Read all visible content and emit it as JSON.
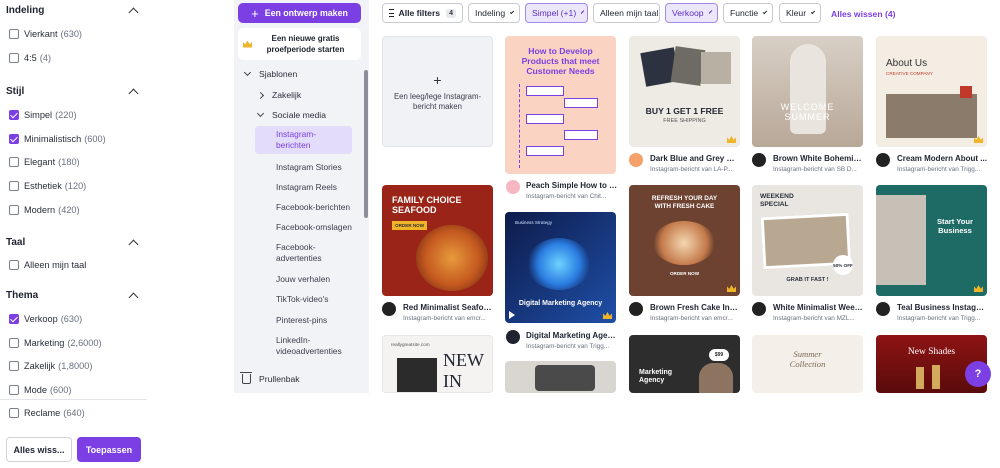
{
  "filters": {
    "sections": [
      {
        "key": "indeling",
        "title": "Indeling",
        "options": [
          {
            "label": "Vierkant",
            "count": "(630)",
            "checked": false
          },
          {
            "label": "4:5",
            "count": "(4)",
            "checked": false
          }
        ]
      },
      {
        "key": "stijl",
        "title": "Stijl",
        "options": [
          {
            "label": "Simpel",
            "count": "(220)",
            "checked": true
          },
          {
            "label": "Minimalistisch",
            "count": "(600)",
            "checked": true
          },
          {
            "label": "Elegant",
            "count": "(180)",
            "checked": false
          },
          {
            "label": "Esthetiek",
            "count": "(120)",
            "checked": false
          },
          {
            "label": "Modern",
            "count": "(420)",
            "checked": false
          }
        ]
      },
      {
        "key": "taal",
        "title": "Taal",
        "options": [
          {
            "label": "Alleen mijn taal",
            "count": "",
            "checked": false
          }
        ]
      },
      {
        "key": "thema",
        "title": "Thema",
        "options": [
          {
            "label": "Verkoop",
            "count": "(630)",
            "checked": true
          },
          {
            "label": "Marketing",
            "count": "(2,6000)",
            "checked": false
          },
          {
            "label": "Zakelijk",
            "count": "(1,8000)",
            "checked": false
          },
          {
            "label": "Mode",
            "count": "(600)",
            "checked": false
          },
          {
            "label": "Reclame",
            "count": "(640)",
            "checked": false
          }
        ]
      }
    ],
    "clear_label": "Alles wiss...",
    "apply_label": "Toepassen"
  },
  "sidebar": {
    "new_design": "Een ontwerp maken",
    "promo": "Een nieuwe gratis proefperiode starten",
    "tree": {
      "sjablonen": "Sjablonen",
      "zakelijk": "Zakelijk",
      "sociale_media": "Sociale media"
    },
    "items": [
      {
        "label": "Instagram-berichten",
        "active": true
      },
      {
        "label": "Instagram Stories",
        "active": false
      },
      {
        "label": "Instagram Reels",
        "active": false
      },
      {
        "label": "Facebook-berichten",
        "active": false
      },
      {
        "label": "Facebook-omslagen",
        "active": false
      },
      {
        "label": "Facebook-advertenties",
        "active": false
      },
      {
        "label": "Jouw verhalen",
        "active": false
      },
      {
        "label": "TikTok-video's",
        "active": false
      },
      {
        "label": "Pinterest-pins",
        "active": false
      },
      {
        "label": "LinkedIn-videoadvertenties",
        "active": false
      }
    ],
    "trash": "Prullenbak"
  },
  "topbar": {
    "all_filters": "Alle filters",
    "all_filters_count": "4",
    "chips": [
      {
        "label": "Indeling",
        "selected": false,
        "dropdown": true
      },
      {
        "label": "Simpel (+1)",
        "selected": true,
        "dropdown": true
      },
      {
        "label": "Alleen mijn taal",
        "selected": false,
        "dropdown": false
      },
      {
        "label": "Verkoop",
        "selected": true,
        "dropdown": true
      },
      {
        "label": "Functie",
        "selected": false,
        "dropdown": true
      },
      {
        "label": "Kleur",
        "selected": false,
        "dropdown": true
      }
    ],
    "clear_all": "Alles wissen (4)"
  },
  "grid": {
    "blank_card": "Een leeg/lege Instagram-bericht maken",
    "templates": [
      {
        "title": "Peach Simple How to D...",
        "meta": "Instagram-bericht van Chit...",
        "thumb_heading": "How to Develop Products that meet Customer Needs"
      },
      {
        "title": "Dark Blue and Grey Mi...",
        "meta": "Instagram-bericht van LA-P...",
        "thumb_heading": "BUY 1 GET 1 FREE",
        "thumb_sub": "FREE SHIPPING"
      },
      {
        "title": "Brown White Bohemia...",
        "meta": "Instagram-bericht van SB D...",
        "thumb_heading": "WELCOME SUMMER"
      },
      {
        "title": "Cream Modern About ...",
        "meta": "Instagram-bericht van Trigg...",
        "thumb_heading": "About Us",
        "thumb_sub": "CREATIVE COMPANY"
      },
      {
        "title": "Red Minimalist Seafoo...",
        "meta": "Instagram-bericht van emcr...",
        "thumb_heading": "FAMILY CHOICE SEAFOOD",
        "thumb_sub": "ORDER NOW"
      },
      {
        "title": "Digital Marketing Agen...",
        "meta": "Instagram-bericht van Trigg...",
        "thumb_heading": "Digital Marketing Agency",
        "thumb_sub": "Business Strategy"
      },
      {
        "title": "Brown Fresh Cake Inst...",
        "meta": "Instagram-bericht van emcr...",
        "thumb_heading": "REFRESH YOUR DAY WITH FRESH CAKE",
        "thumb_sub": "ORDER NOW"
      },
      {
        "title": "White Minimalist Week...",
        "meta": "Instagram-bericht van MZL...",
        "thumb_heading": "WEEKEND SPECIAL",
        "thumb_sub": "GRAB IT FAST !",
        "thumb_badge": "50% OFF"
      },
      {
        "title": "Teal Business Instagra...",
        "meta": "Instagram-bericht van Trigg...",
        "thumb_heading": "Start Your Business"
      },
      {
        "thumb_heading": "NEW IN",
        "thumb_sub": "reallygreatsite.com"
      },
      {
        "thumb_heading": ""
      },
      {
        "thumb_heading": "Marketing Agency",
        "thumb_badge": "$99"
      },
      {
        "thumb_heading": "Summer Collection"
      },
      {
        "thumb_heading": "New Shades"
      }
    ]
  },
  "help": "?",
  "colors": {
    "accent": "#7b3fe4"
  }
}
